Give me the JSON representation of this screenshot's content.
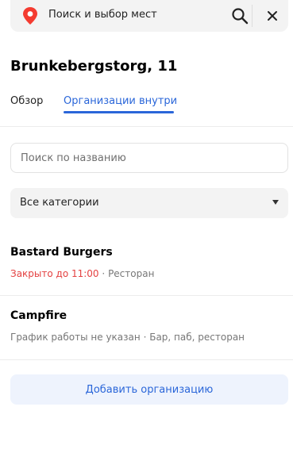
{
  "header": {
    "search_label": "Поиск и выбор мест"
  },
  "place": {
    "title": "Brunkebergstorg, 11"
  },
  "tabs": [
    {
      "label": "Обзор"
    },
    {
      "label": "Организации внутри"
    }
  ],
  "search": {
    "placeholder": "Поиск по названию"
  },
  "category_select": {
    "selected": "Все категории"
  },
  "organizations": [
    {
      "name": "Bastard Burgers",
      "status": "Закрыто до 11:00",
      "separator": "·",
      "category": "Ресторан"
    },
    {
      "name": "Campfire",
      "status": "График работы не указан",
      "separator": "·",
      "category": "Бар, паб, ресторан"
    }
  ],
  "add_button": {
    "label": "Добавить организацию"
  },
  "colors": {
    "accent": "#2a66d9",
    "closed": "#e44141",
    "pin": "#f43b30"
  }
}
